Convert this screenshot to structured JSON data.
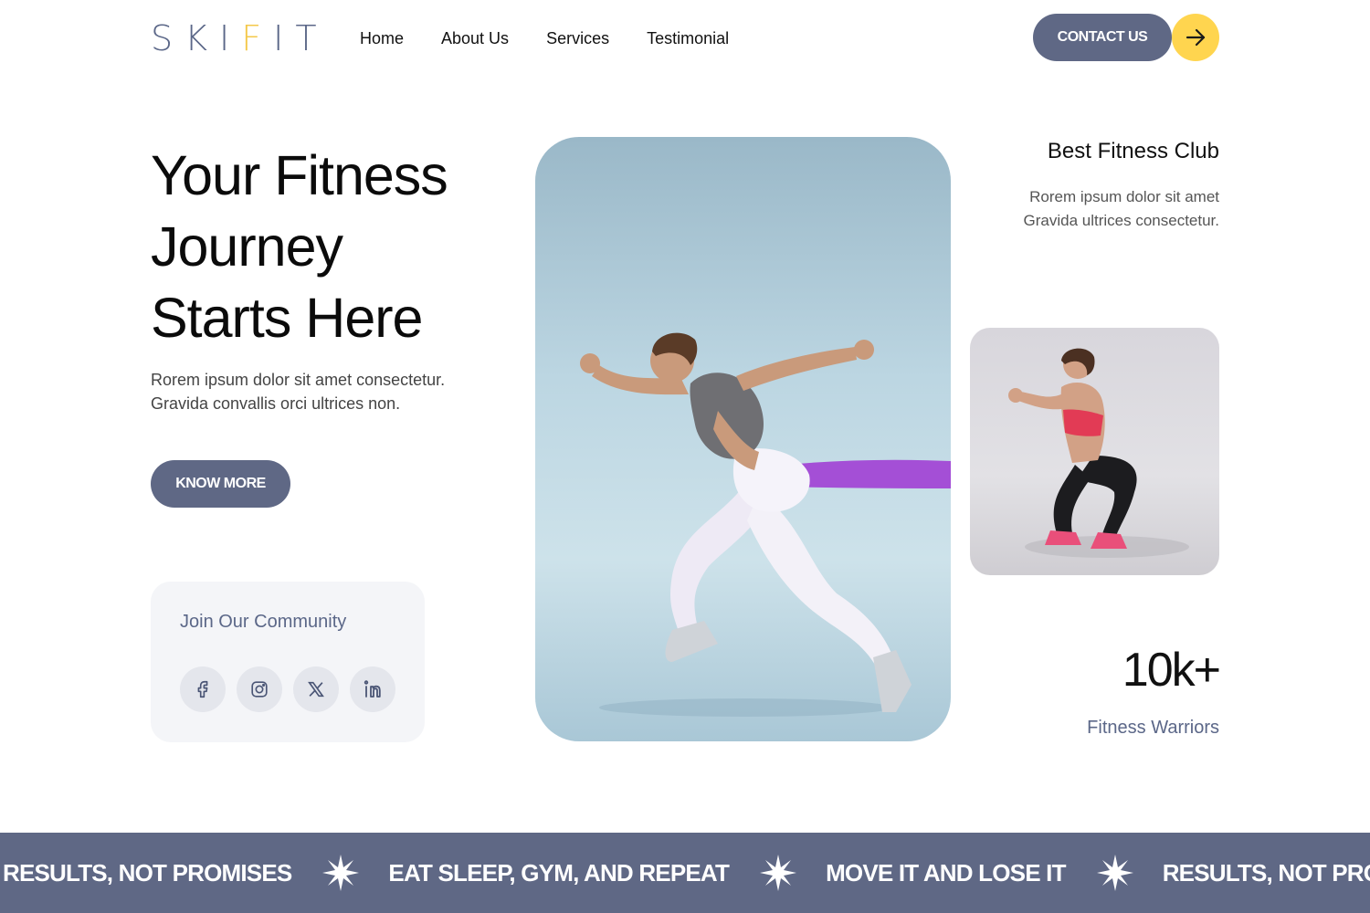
{
  "header": {
    "logo_left": "SKI",
    "logo_accent": "F",
    "logo_right": "IT",
    "nav": [
      "Home",
      "About Us",
      "Services",
      "Testimonial"
    ],
    "contact_label": "CONTACT US",
    "arrow_icon": "arrow-right-icon"
  },
  "hero": {
    "title_lines": [
      "Your Fitness",
      "Journey",
      "Starts Here"
    ],
    "desc_lines": [
      "Rorem ipsum dolor sit amet consectetur.",
      "Gravida convallis orci ultrices non."
    ],
    "cta_label": "KNOW MORE"
  },
  "community": {
    "title": "Join Our Community",
    "socials": [
      "facebook-icon",
      "instagram-icon",
      "x-icon",
      "linkedin-icon"
    ]
  },
  "club": {
    "title": "Best Fitness Club",
    "desc_lines": [
      "Rorem ipsum dolor sit amet",
      "Gravida ultrices consectetur."
    ]
  },
  "stat": {
    "value": "10k+",
    "label": "Fitness Warriors"
  },
  "marquee": {
    "items": [
      "RESULTS, NOT PROMISES",
      "EAT SLEEP, GYM, AND REPEAT",
      "MOVE IT AND LOSE IT",
      "RESULTS, NOT PROMISES"
    ],
    "separator_icon": "star-burst-icon"
  },
  "colors": {
    "primary": "#5f6885",
    "accent": "#ffd54f",
    "text_muted": "#5b6788"
  }
}
